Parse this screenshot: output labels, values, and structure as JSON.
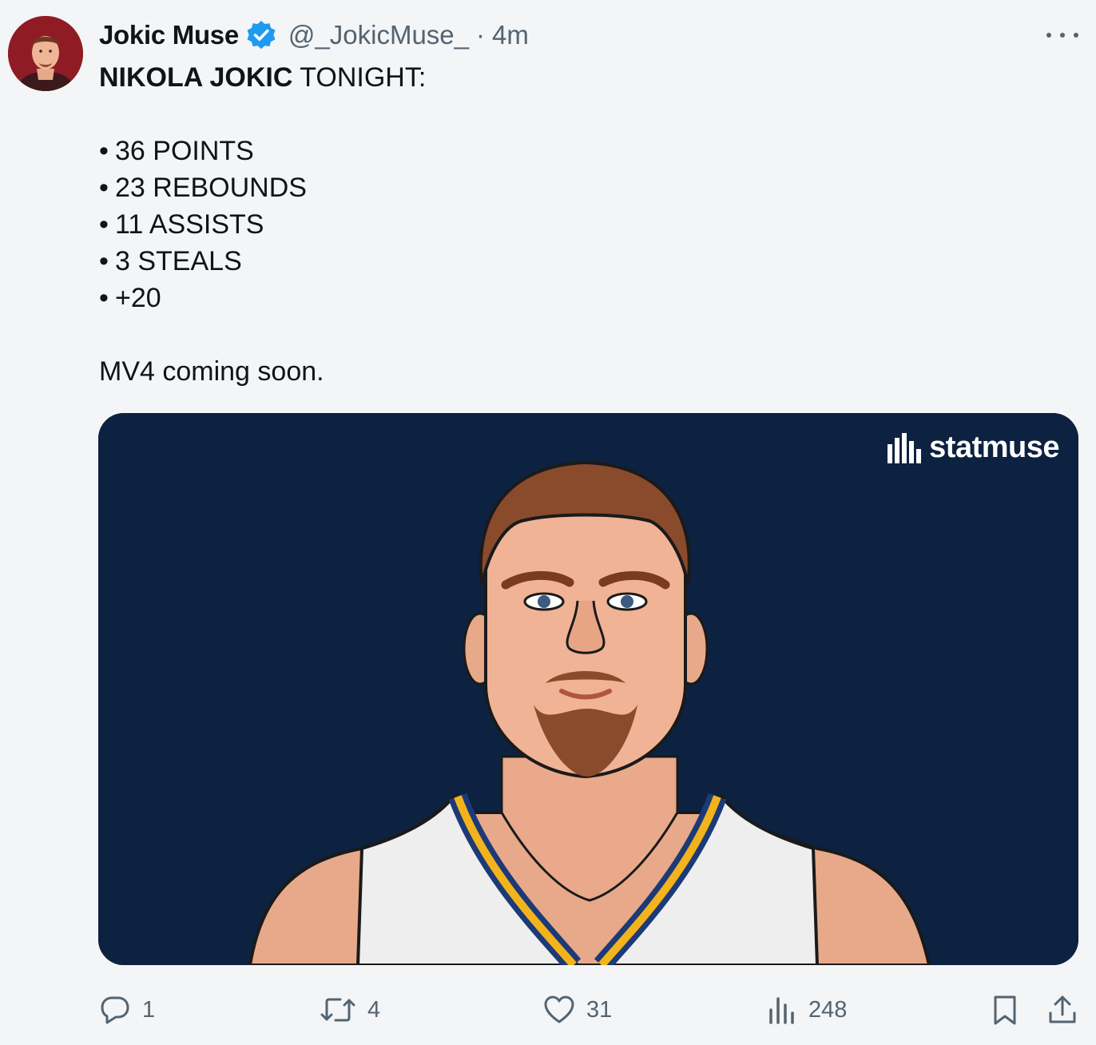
{
  "user": {
    "display_name": "Jokic Muse",
    "handle": "@_JokicMuse_",
    "separator": "·",
    "time": "4m",
    "verified": true
  },
  "tweet": {
    "headline_bold": "NIKOLA JOKIC",
    "headline_rest": " TONIGHT:",
    "stats": [
      "36 POINTS",
      "23 REBOUNDS",
      "11 ASSISTS",
      "3 STEALS",
      "+20"
    ],
    "bullet": "•",
    "closing": "MV4 coming soon."
  },
  "media": {
    "brand": "statmuse",
    "background_color": "#0d2240"
  },
  "actions": {
    "replies": "1",
    "reposts": "4",
    "likes": "31",
    "views": "248"
  },
  "icons": {
    "verified": "verified-badge-icon",
    "more": "more-icon",
    "reply": "reply-icon",
    "repost": "repost-icon",
    "like": "heart-icon",
    "views": "views-icon",
    "bookmark": "bookmark-icon",
    "share": "share-icon"
  },
  "colors": {
    "accent": "#1d9bf0",
    "muted": "#536471",
    "text": "#0f1419"
  }
}
